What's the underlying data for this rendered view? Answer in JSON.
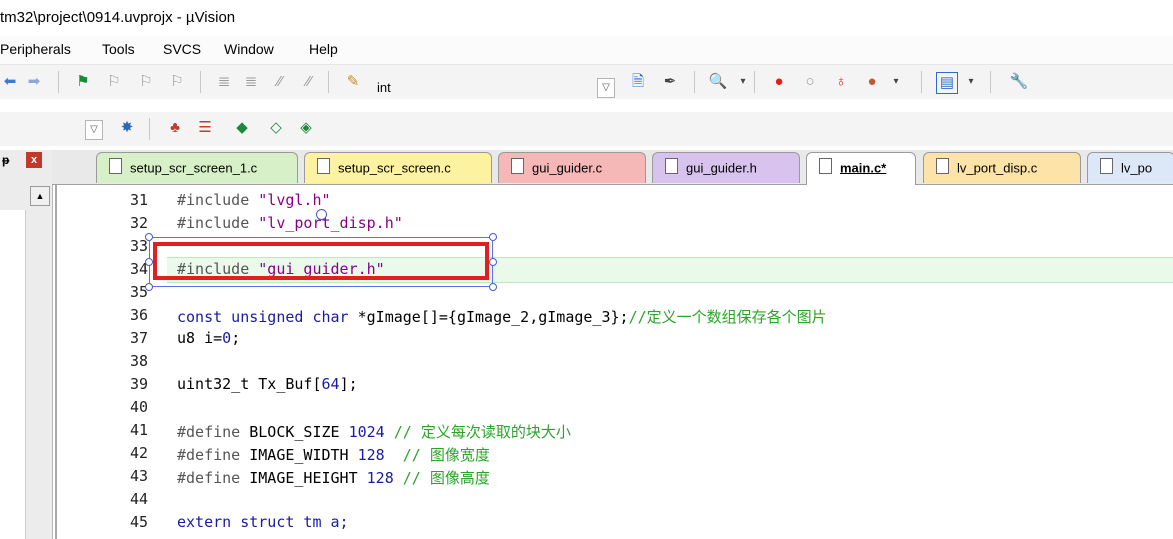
{
  "window": {
    "title": "tm32\\project\\0914.uvprojx - µVision"
  },
  "menu": [
    "Peripherals",
    "Tools",
    "SVCS",
    "Window",
    "Help"
  ],
  "toolbar1": {
    "target_value": "int",
    "icons": [
      "back-arrow-icon",
      "forward-arrow-icon",
      "bookmark-icon",
      "prev-bookmark-icon",
      "next-bookmark-icon",
      "clear-bookmarks-icon",
      "indent-icon",
      "unindent-icon",
      "comment-icon",
      "uncomment-icon",
      "find-in-files-icon",
      "find-icon",
      "configure-icon",
      "debug-icon",
      "breakpoint-icon",
      "disabled-breakpoint-icon",
      "kill-breakpoints-icon",
      "watch-icon",
      "window-layout-icon",
      "tools-icon"
    ]
  },
  "toolbar2": {
    "icons": [
      "wizard-icon",
      "target-icon",
      "build-icon",
      "download-icon",
      "rebuild-icon",
      "batch-icon"
    ]
  },
  "panel": {
    "pin_glyph": "ᵽ",
    "close_glyph": "x"
  },
  "tabs": [
    {
      "label": "setup_scr_screen_1.c",
      "color": "#d8f0c8"
    },
    {
      "label": "setup_scr_screen.c",
      "color": "#fdf2a0"
    },
    {
      "label": "gui_guider.c",
      "color": "#f6b7b7"
    },
    {
      "label": "gui_guider.h",
      "color": "#d8c3ef"
    },
    {
      "label": "main.c*",
      "color": "#ffffff"
    },
    {
      "label": "lv_port_disp.c",
      "color": "#fde3a8"
    },
    {
      "label": "lv_po",
      "color": "#dce7f7"
    }
  ],
  "code": {
    "lines": [
      {
        "num": "31",
        "parts": [
          {
            "t": "#include ",
            "c": "pp"
          },
          {
            "t": "\"lvgl.h\"",
            "c": "c2"
          }
        ]
      },
      {
        "num": "32",
        "parts": [
          {
            "t": "#include ",
            "c": "pp"
          },
          {
            "t": "\"lv_port_disp.h\"",
            "c": "c2"
          }
        ]
      },
      {
        "num": "33",
        "parts": []
      },
      {
        "num": "34",
        "parts": [
          {
            "t": "#include ",
            "c": "pp"
          },
          {
            "t": "\"gui_guider.h\"",
            "c": "c2"
          }
        ]
      },
      {
        "num": "35",
        "parts": []
      },
      {
        "num": "36",
        "parts": [
          {
            "t": "const unsigned char ",
            "c": "c1"
          },
          {
            "t": "*gImage[]={gImage_2,gImage_3};",
            "c": ""
          },
          {
            "t": "//定义一个数组保存各个图片",
            "c": "c3"
          }
        ]
      },
      {
        "num": "37",
        "parts": [
          {
            "t": "u8 i=",
            "c": ""
          },
          {
            "t": "0",
            "c": "c1"
          },
          {
            "t": ";",
            "c": ""
          }
        ]
      },
      {
        "num": "38",
        "parts": []
      },
      {
        "num": "39",
        "parts": [
          {
            "t": "uint32_t Tx_Buf[",
            "c": ""
          },
          {
            "t": "64",
            "c": "c1"
          },
          {
            "t": "];",
            "c": ""
          }
        ]
      },
      {
        "num": "40",
        "parts": []
      },
      {
        "num": "41",
        "parts": [
          {
            "t": "#define ",
            "c": "pp"
          },
          {
            "t": "BLOCK_SIZE ",
            "c": ""
          },
          {
            "t": "1024 ",
            "c": "c1"
          },
          {
            "t": "// 定义每次读取的块大小",
            "c": "c3"
          }
        ]
      },
      {
        "num": "42",
        "parts": [
          {
            "t": "#define ",
            "c": "pp"
          },
          {
            "t": "IMAGE_WIDTH ",
            "c": ""
          },
          {
            "t": "128  ",
            "c": "c1"
          },
          {
            "t": "// 图像宽度",
            "c": "c3"
          }
        ]
      },
      {
        "num": "43",
        "parts": [
          {
            "t": "#define ",
            "c": "pp"
          },
          {
            "t": "IMAGE_HEIGHT ",
            "c": ""
          },
          {
            "t": "128 ",
            "c": "c1"
          },
          {
            "t": "// 图像高度",
            "c": "c3"
          }
        ]
      },
      {
        "num": "44",
        "parts": []
      },
      {
        "num": "45",
        "parts": [
          {
            "t": "extern struct tm a;",
            "c": "c1"
          }
        ]
      }
    ]
  }
}
